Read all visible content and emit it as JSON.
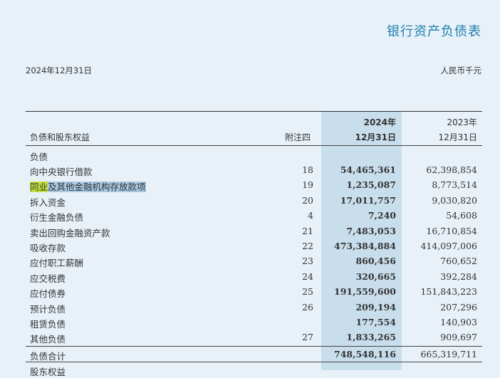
{
  "title": "银行资产负债表",
  "date": "2024年12月31日",
  "unit": "人民币千元",
  "header": {
    "label": "负债和股东权益",
    "note": "附注四",
    "col1_year": "2024年",
    "col1_date": "12月31日",
    "col2_year": "2023年",
    "col2_date": "12月31日"
  },
  "section": "负债",
  "rows": [
    {
      "label": "向中央银行借款",
      "note": "18",
      "v2024": "54,465,361",
      "v2023": "62,398,854"
    },
    {
      "label_a": "同业",
      "label_b": "及其他金融机构存放款项",
      "note": "19",
      "v2024": "1,235,087",
      "v2023": "8,773,514"
    },
    {
      "label": "拆入资金",
      "note": "20",
      "v2024": "17,011,757",
      "v2023": "9,030,820"
    },
    {
      "label": "衍生金融负债",
      "note": "4",
      "v2024": "7,240",
      "v2023": "54,608"
    },
    {
      "label": "卖出回购金融资产款",
      "note": "21",
      "v2024": "7,483,053",
      "v2023": "16,710,854"
    },
    {
      "label": "吸收存款",
      "note": "22",
      "v2024": "473,384,884",
      "v2023": "414,097,006"
    },
    {
      "label": "应付职工薪酬",
      "note": "23",
      "v2024": "860,456",
      "v2023": "760,652"
    },
    {
      "label": "应交税费",
      "note": "24",
      "v2024": "320,665",
      "v2023": "392,284"
    },
    {
      "label": "应付债券",
      "note": "25",
      "v2024": "191,559,600",
      "v2023": "151,843,223"
    },
    {
      "label": "预计负债",
      "note": "26",
      "v2024": "209,194",
      "v2023": "207,296"
    },
    {
      "label": "租赁负债",
      "note": "",
      "v2024": "177,554",
      "v2023": "140,903"
    },
    {
      "label": "其他负债",
      "note": "27",
      "v2024": "1,833,265",
      "v2023": "909,697"
    }
  ],
  "total": {
    "label": "负债合计",
    "v2024": "748,548,116",
    "v2023": "665,319,711"
  },
  "next_section": "股东权益"
}
